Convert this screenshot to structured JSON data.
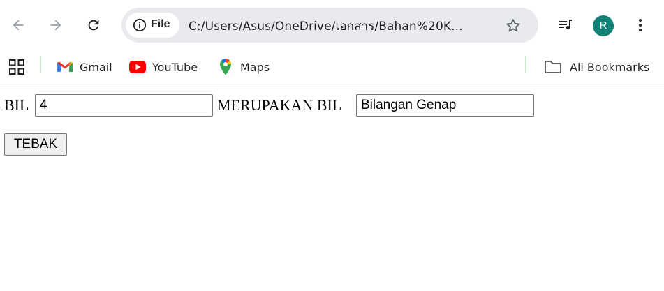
{
  "toolbar": {
    "back_icon": "arrow-left-icon",
    "forward_icon": "arrow-right-icon",
    "reload_icon": "reload-icon",
    "site_info_label": "File",
    "url": "C:/Users/Asus/OneDrive/เอกสาร/Bahan%20K...",
    "avatar_letter": "R",
    "avatar_color": "#128277"
  },
  "bookmarks": {
    "items": [
      {
        "label": "Gmail",
        "icon": "gmail-icon"
      },
      {
        "label": "YouTube",
        "icon": "youtube-icon"
      },
      {
        "label": "Maps",
        "icon": "maps-icon"
      }
    ],
    "all_bookmarks_label": "All Bookmarks"
  },
  "form": {
    "label_bil": "BIL",
    "number_value": "4",
    "label_merupakan": "MERUPAKAN BIL",
    "result_value": "Bilangan Genap",
    "button_label": "TEBAK"
  }
}
